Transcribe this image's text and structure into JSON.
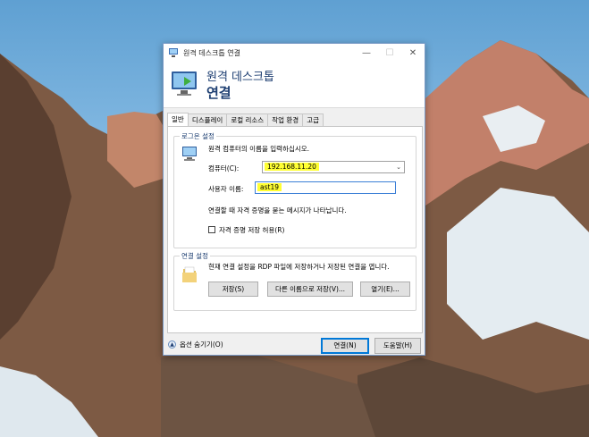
{
  "window": {
    "title": "원격 데스크톱 연결",
    "controls": {
      "minimize": "—",
      "maximize": "☐",
      "close": "✕"
    }
  },
  "banner": {
    "line1": "원격 데스크톱",
    "line2": "연결"
  },
  "tabs": [
    {
      "label": "일반",
      "active": true
    },
    {
      "label": "디스플레이",
      "active": false
    },
    {
      "label": "로컬 리소스",
      "active": false
    },
    {
      "label": "작업 환경",
      "active": false
    },
    {
      "label": "고급",
      "active": false
    }
  ],
  "login_settings": {
    "legend": "로그온 설정",
    "prompt": "원격 컴퓨터의 이름을 입력하십시오.",
    "computer_label": "컴퓨터(C):",
    "computer_value": "192.168.11.20",
    "user_label": "사용자 이름:",
    "user_value": "ast19",
    "note": "연결할 때 자격 증명을 묻는 메시지가 나타납니다.",
    "save_credentials_label": "자격 증명 저장 허용(R)",
    "save_credentials_checked": false
  },
  "connection_settings": {
    "legend": "연결 설정",
    "description": "현재 연결 설정을 RDP 파일에 저장하거나 저장된 연결을 엽니다.",
    "save_label": "저장(S)",
    "save_as_label": "다른 이름으로 저장(V)...",
    "open_label": "열기(E)..."
  },
  "footer": {
    "options_label": "옵션 숨기기(O)",
    "connect_label": "연결(N)",
    "help_label": "도움말(H)"
  },
  "colors": {
    "accent": "#0078d7",
    "banner_text": "#1e3f72",
    "highlight": "#ffff33"
  },
  "icons": [
    "remote-desktop-icon",
    "computer-icon",
    "folder-icon",
    "chevron-up-icon"
  ]
}
